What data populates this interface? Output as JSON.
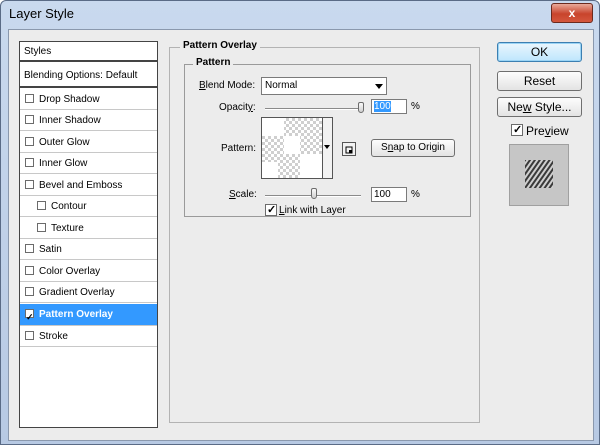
{
  "window": {
    "title": "Layer Style",
    "close_glyph": "x"
  },
  "styles_panel": {
    "header": "Styles",
    "blending_options": "Blending Options: Default",
    "items": [
      {
        "label": "Drop Shadow",
        "checked": false
      },
      {
        "label": "Inner Shadow",
        "checked": false
      },
      {
        "label": "Outer Glow",
        "checked": false
      },
      {
        "label": "Inner Glow",
        "checked": false
      },
      {
        "label": "Bevel and Emboss",
        "checked": false
      },
      {
        "label": "Contour",
        "checked": false
      },
      {
        "label": "Texture",
        "checked": false
      },
      {
        "label": "Satin",
        "checked": false
      },
      {
        "label": "Color Overlay",
        "checked": false
      },
      {
        "label": "Gradient Overlay",
        "checked": false
      },
      {
        "label": "Pattern Overlay",
        "checked": true,
        "selected": true
      },
      {
        "label": "Stroke",
        "checked": false
      }
    ]
  },
  "pattern_overlay": {
    "group_title": "Pattern Overlay",
    "subgroup_title": "Pattern",
    "blend_mode": {
      "label_mnemonic": "B",
      "label_rest": "lend Mode:",
      "value": "Normal"
    },
    "opacity": {
      "label_head": "Opacit",
      "label_mnemonic": "y",
      "label_tail": ":",
      "value": "100",
      "unit": "%",
      "level": 1.0
    },
    "pattern": {
      "label": "Pattern:",
      "snap_mnemonic": "n",
      "snap_head": "S",
      "snap_tail": "ap to Origin"
    },
    "scale": {
      "label_mnemonic": "S",
      "label_rest": "cale:",
      "value": "100",
      "unit": "%",
      "level": 0.5
    },
    "link_with_layer": {
      "label_mnemonic": "L",
      "label_rest": "ink with Layer",
      "checked": true
    }
  },
  "buttons": {
    "ok": "OK",
    "reset": "Reset",
    "new_style_mnemonic": "w",
    "new_style_head": "Ne",
    "new_style_tail": " Style...",
    "preview_mnemonic": "v",
    "preview_head": "Pre",
    "preview_tail": "iew",
    "preview_checked": true
  }
}
